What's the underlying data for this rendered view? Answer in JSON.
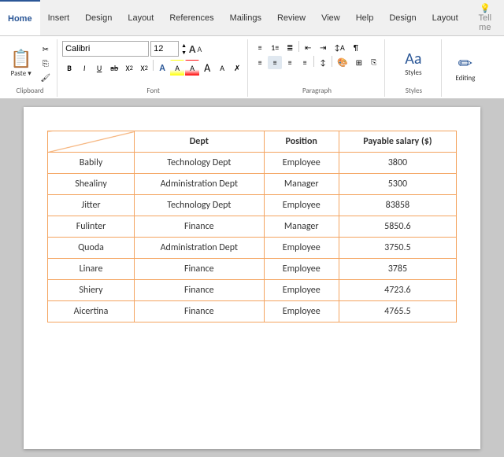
{
  "ribbon": {
    "tabs": [
      {
        "label": "Home",
        "active": true
      },
      {
        "label": "Insert",
        "active": false
      },
      {
        "label": "Design",
        "active": false
      },
      {
        "label": "Layout",
        "active": false
      },
      {
        "label": "References",
        "active": false
      },
      {
        "label": "Mailings",
        "active": false
      },
      {
        "label": "Review",
        "active": false
      },
      {
        "label": "View",
        "active": false
      },
      {
        "label": "Help",
        "active": false
      },
      {
        "label": "Design",
        "active": false
      },
      {
        "label": "Layout",
        "active": false
      },
      {
        "label": "Tell me",
        "active": false
      }
    ],
    "font": {
      "name": "Calibri",
      "size": "12",
      "grow_label": "A",
      "shrink_label": "A"
    },
    "formatting": {
      "bold": "B",
      "italic": "I",
      "underline": "U",
      "strikethrough": "ab",
      "subscript": "X₂",
      "superscript": "X²",
      "clear": "✗"
    },
    "groups": {
      "clipboard_label": "Clipboard",
      "font_label": "Font",
      "paragraph_label": "Paragraph",
      "styles_label": "Styles"
    },
    "editing_label": "Editing"
  },
  "table": {
    "headers": [
      "",
      "Dept",
      "Position",
      "Payable salary ($)"
    ],
    "rows": [
      {
        "name": "Babily",
        "dept": "Technology Dept",
        "position": "Employee",
        "salary": "3800"
      },
      {
        "name": "Shealiny",
        "dept": "Administration Dept",
        "position": "Manager",
        "salary": "5300"
      },
      {
        "name": "Jitter",
        "dept": "Technology Dept",
        "position": "Employee",
        "salary": "83858"
      },
      {
        "name": "Fulinter",
        "dept": "Finance",
        "position": "Manager",
        "salary": "5850.6"
      },
      {
        "name": "Quoda",
        "dept": "Administration Dept",
        "position": "Employee",
        "salary": "3750.5"
      },
      {
        "name": "Linare",
        "dept": "Finance",
        "position": "Employee",
        "salary": "3785"
      },
      {
        "name": "Shiery",
        "dept": "Finance",
        "position": "Employee",
        "salary": "4723.6"
      },
      {
        "name": "Aicertina",
        "dept": "Finance",
        "position": "Employee",
        "salary": "4765.5"
      }
    ]
  }
}
